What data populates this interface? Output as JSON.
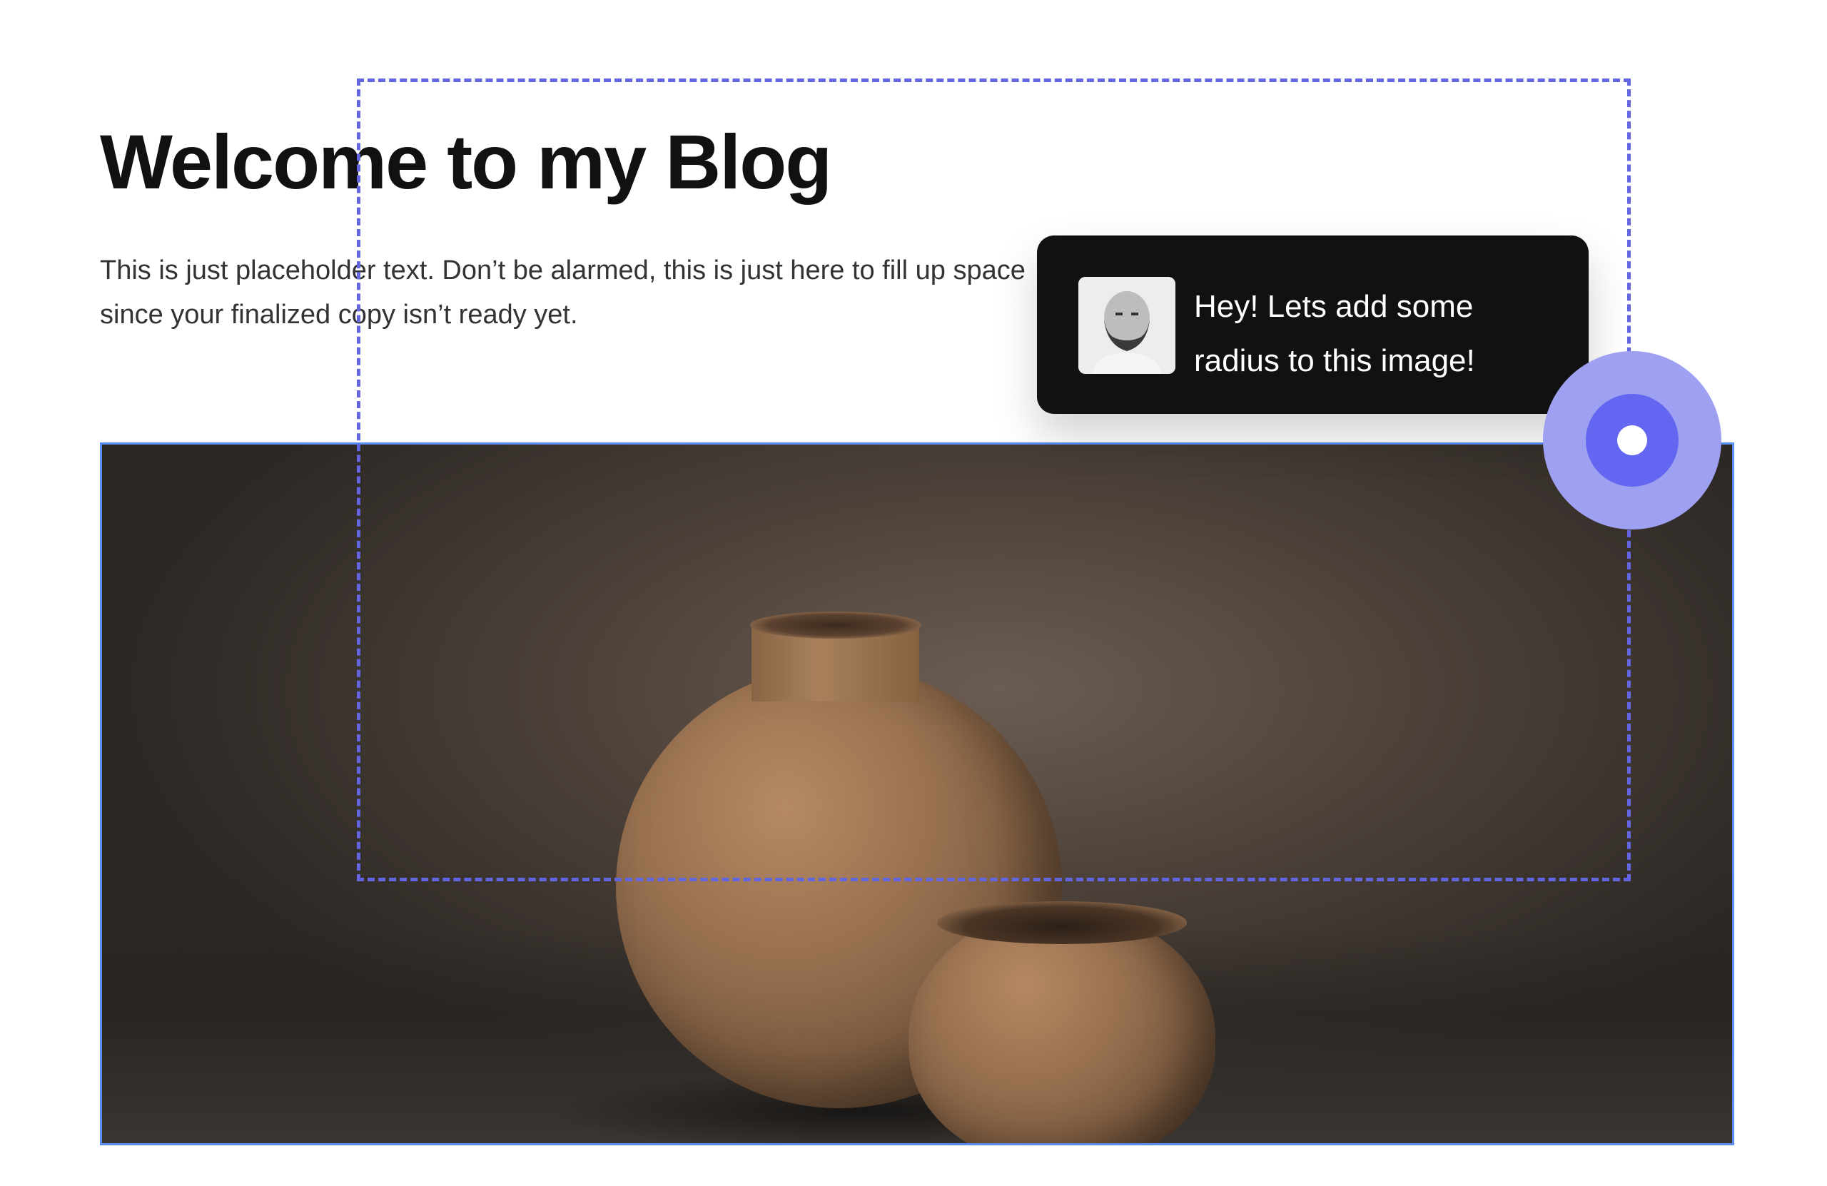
{
  "page": {
    "title": "Welcome to my Blog",
    "intro": "This is just placeholder text. Don’t be alarmed, this is just here to fill up space since your finalized copy isn’t ready yet."
  },
  "hero_image": {
    "subject": "two textured ceramic vases",
    "selection_color": "#5b8def"
  },
  "comment": {
    "text": "Hey! Lets add some radius to this image!",
    "background": "#111111",
    "avatar": "user-avatar"
  },
  "selection_outline": {
    "style": "dashed",
    "color": "#6366e0"
  },
  "cursor_marker": {
    "color": "#6366f1",
    "halo_color": "#9ea0f2"
  }
}
